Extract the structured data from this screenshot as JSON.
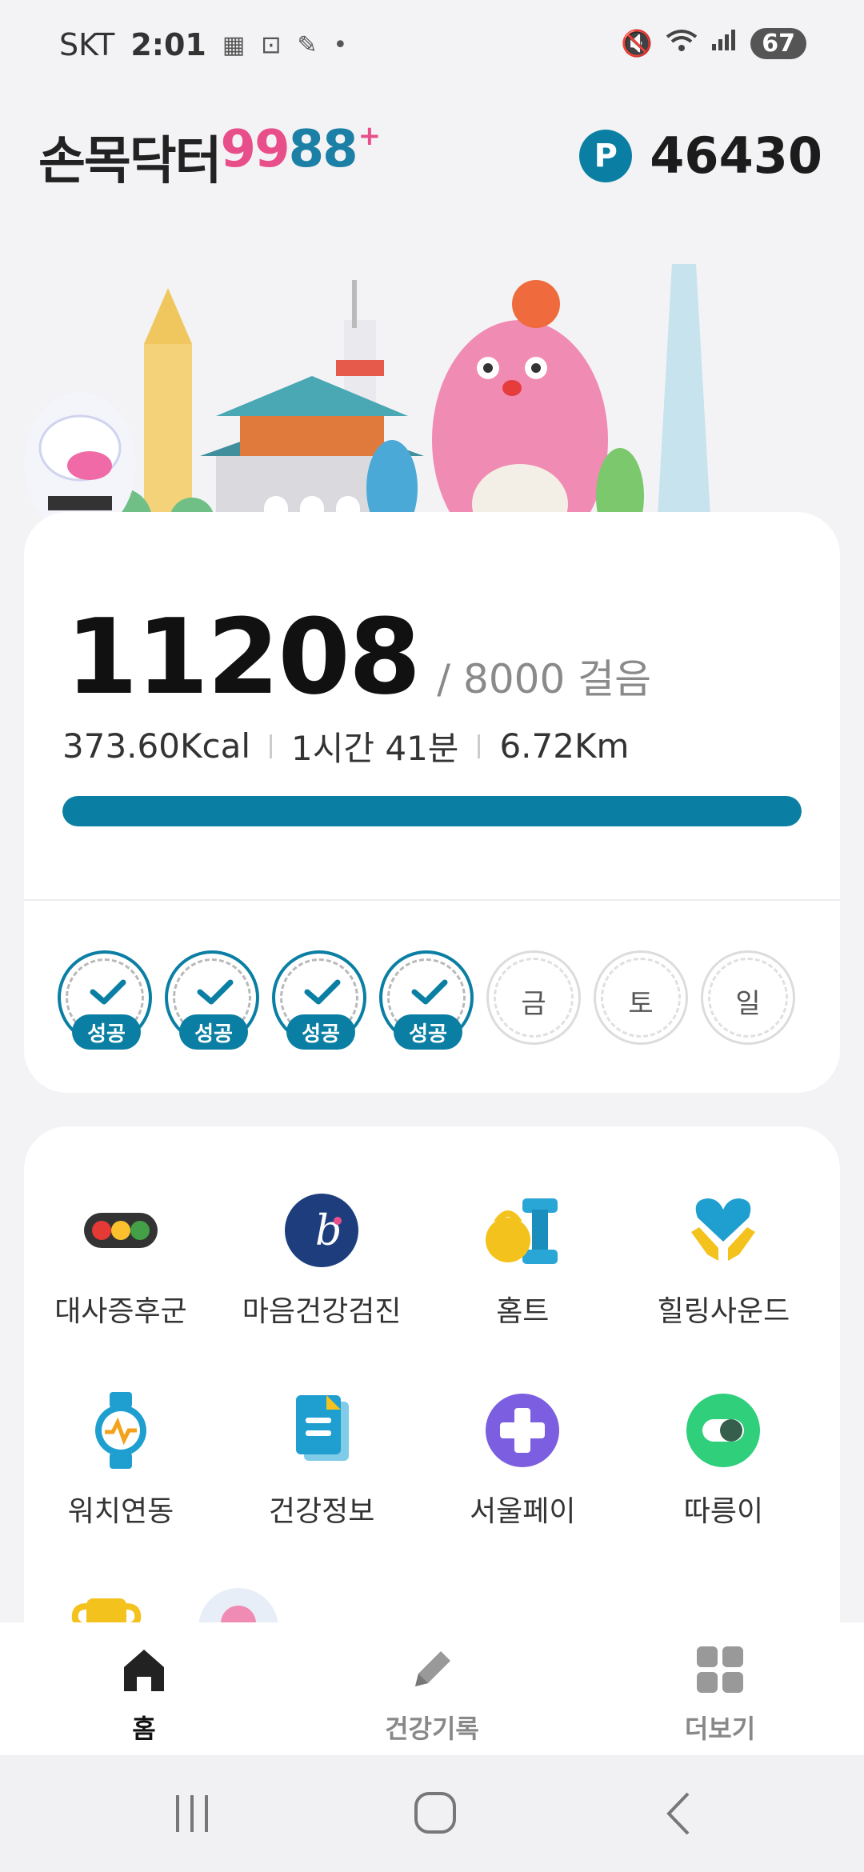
{
  "status": {
    "carrier": "SKT",
    "time": "2:01",
    "battery": "67"
  },
  "header": {
    "logo_main": "손목닥터",
    "logo_num1": "99",
    "logo_num2": "88",
    "logo_plus": "+",
    "points_badge": "P",
    "points": "46430"
  },
  "steps": {
    "count": "11208",
    "goal": "/ 8000 걸음",
    "kcal": "373.60Kcal",
    "duration": "1시간 41분",
    "distance": "6.72Km",
    "progress": 1.0
  },
  "week": [
    {
      "label": "",
      "status": "성공",
      "done": true
    },
    {
      "label": "",
      "status": "성공",
      "done": true
    },
    {
      "label": "",
      "status": "성공",
      "done": true
    },
    {
      "label": "",
      "status": "성공",
      "done": true
    },
    {
      "label": "금",
      "status": "",
      "done": false
    },
    {
      "label": "토",
      "status": "",
      "done": false
    },
    {
      "label": "일",
      "status": "",
      "done": false
    }
  ],
  "menu": [
    {
      "label": "대사증후군",
      "icon": "traffic-light-icon"
    },
    {
      "label": "마음건강검진",
      "icon": "mind-check-icon"
    },
    {
      "label": "홈트",
      "icon": "kettlebell-icon"
    },
    {
      "label": "힐링사운드",
      "icon": "heart-hands-icon"
    },
    {
      "label": "워치연동",
      "icon": "smartwatch-icon"
    },
    {
      "label": "건강정보",
      "icon": "document-icon"
    },
    {
      "label": "서울페이",
      "icon": "seoul-pay-icon"
    },
    {
      "label": "따릉이",
      "icon": "bike-share-icon"
    }
  ],
  "nav": {
    "home": "홈",
    "records": "건강기록",
    "more": "더보기"
  },
  "colors": {
    "accent": "#0b7fa3",
    "brand_pink": "#e84f8a"
  }
}
